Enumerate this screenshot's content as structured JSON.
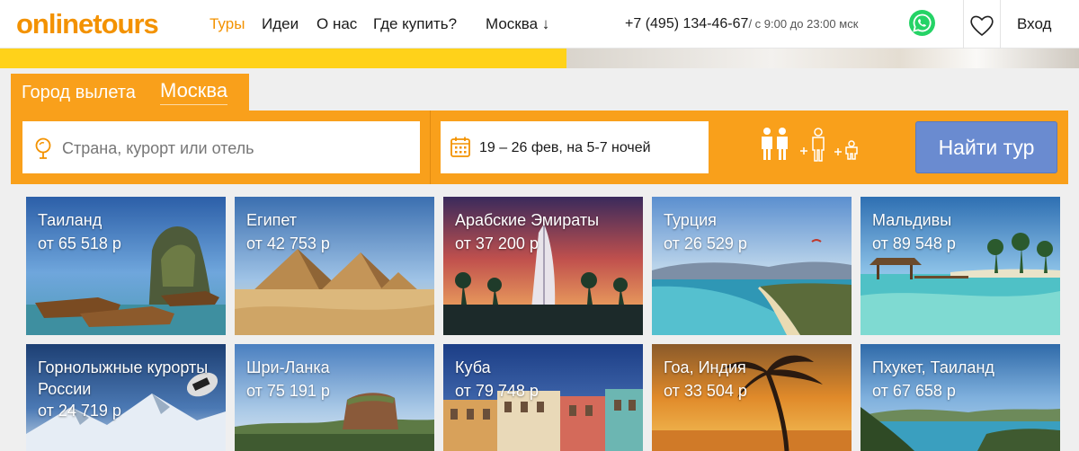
{
  "header": {
    "logo": "onlinetours",
    "nav": [
      "Туры",
      "Идеи",
      "О нас",
      "Где купить?"
    ],
    "city": "Москва ↓",
    "phone": "+7 (495) 134-46-67",
    "schedule": "/ с 9:00 до 23:00 мск",
    "login": "Вход",
    "icons": [
      "whatsapp-icon",
      "heart-icon"
    ]
  },
  "search": {
    "departure_label": "Город вылета",
    "departure_value": "Москва",
    "destination_placeholder": "Страна, курорт или отель",
    "dates": "19 – 26 фев, на 5-7 ночей",
    "submit_label": "Найти тур",
    "icons": [
      "location-pin-icon",
      "calendar-icon",
      "two-adults-icon",
      "add-adult-icon",
      "add-child-icon"
    ]
  },
  "destinations": [
    {
      "title": "Таиланд",
      "price": "от 65 518 р"
    },
    {
      "title": "Египет",
      "price": "от 42 753 р"
    },
    {
      "title": "Арабские Эмираты",
      "price": "от 37 200 р"
    },
    {
      "title": "Турция",
      "price": "от 26 529 р"
    },
    {
      "title": "Мальдивы",
      "price": "от 89 548 р"
    },
    {
      "title": "Горнолыжные курорты России",
      "price": "от 24 719 р"
    },
    {
      "title": "Шри-Ланка",
      "price": "от 75 191 р"
    },
    {
      "title": "Куба",
      "price": "от 79 748 р"
    },
    {
      "title": "Гоа, Индия",
      "price": "от 33 504 р"
    },
    {
      "title": "Пхукет, Таиланд",
      "price": "от 67 658 р"
    }
  ],
  "colors": {
    "brand": "#f39200",
    "search_bg": "#f9a01b",
    "button": "#6a8bd0",
    "banner": "#ffd21a"
  }
}
